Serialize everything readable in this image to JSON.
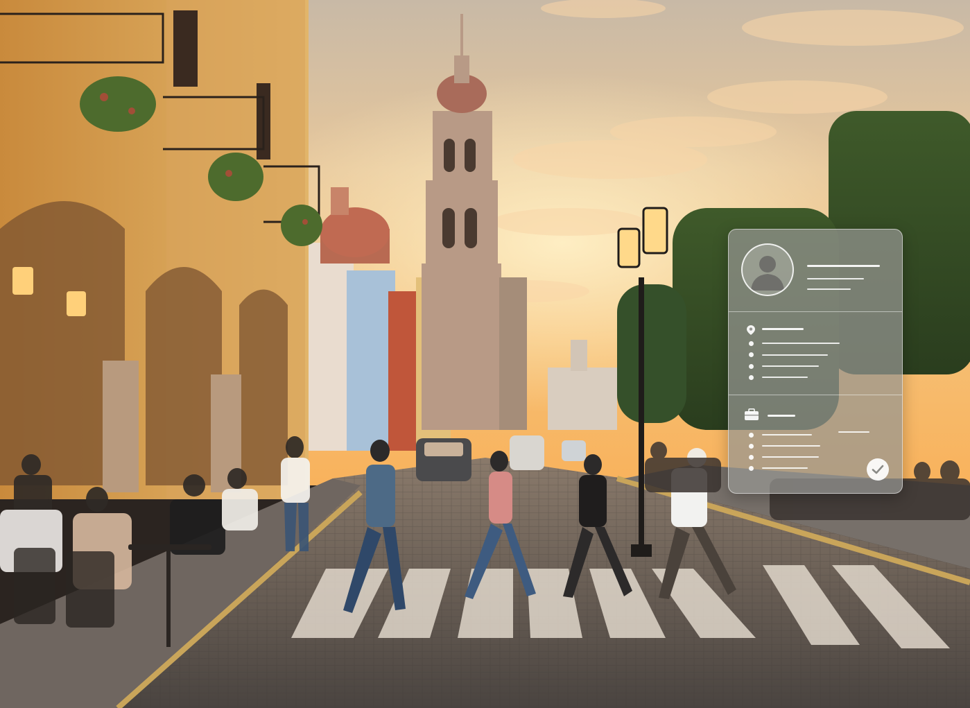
{
  "scene": {
    "sky_top": "#c9b7a2",
    "sky_glow": "#f2c27a",
    "horizon": "#f6b862",
    "stone": "#d9a65a",
    "street": "#5b5551"
  },
  "card": {
    "background": "#969692",
    "avatar_icon": "user-silhouette-icon",
    "bullet_icon": "location-pin-icon",
    "section_icon": "briefcase-icon",
    "status_icon": "check-circle-icon"
  }
}
